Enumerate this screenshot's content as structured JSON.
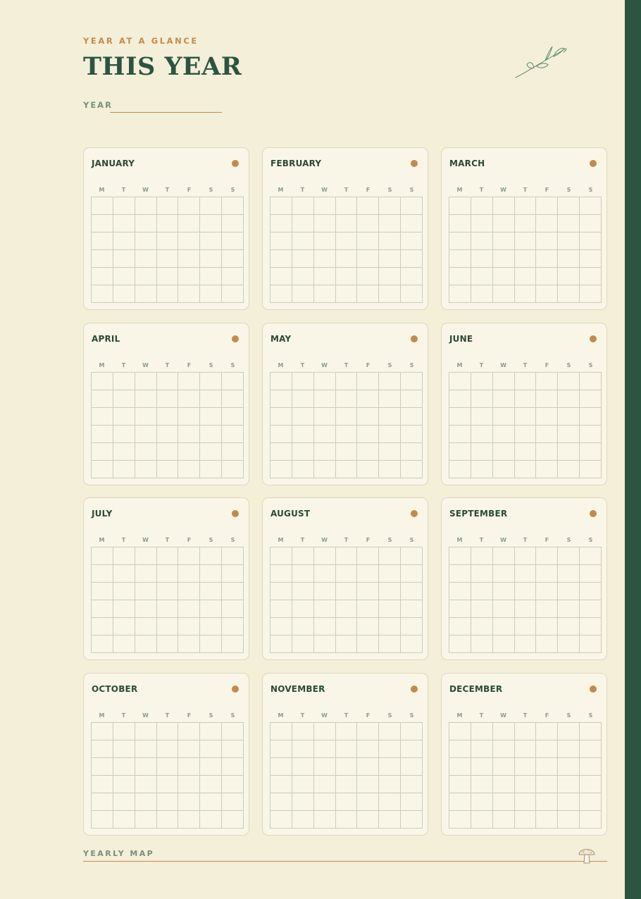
{
  "header": {
    "eyebrow": "YEAR AT A GLANCE",
    "title": "THIS YEAR",
    "year_label": "YEAR"
  },
  "weekdays": [
    "M",
    "T",
    "W",
    "T",
    "F",
    "S",
    "S"
  ],
  "months": [
    "JANUARY",
    "FEBRUARY",
    "MARCH",
    "APRIL",
    "MAY",
    "JUNE",
    "JULY",
    "AUGUST",
    "SEPTEMBER",
    "OCTOBER",
    "NOVEMBER",
    "DECEMBER"
  ],
  "grid": {
    "rows": 6,
    "cols": 7
  },
  "footer": {
    "label": "YEARLY MAP"
  },
  "icons": {
    "decoration_top": "leaf-sprig-icon",
    "decoration_bottom": "mushroom-icon"
  },
  "colors": {
    "background": "#f4efd8",
    "card": "#f9f6e8",
    "accent": "#c48a4c",
    "forest_green": "#2c5440",
    "muted_text": "#7a8f7e"
  }
}
